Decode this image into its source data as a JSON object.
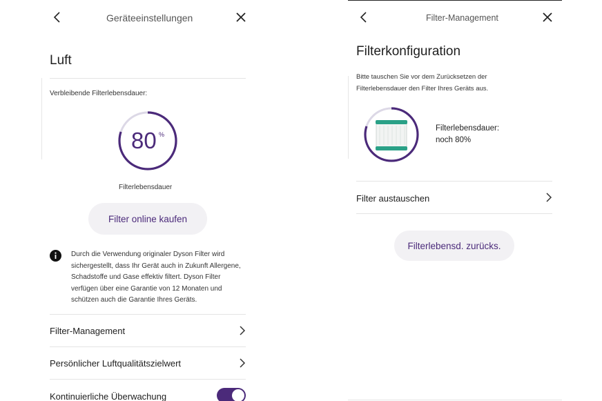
{
  "colors": {
    "accent": "#4b2a7a",
    "ring_track": "#dcd8e6",
    "toggle_on": "#4b2a7a",
    "pill_bg": "#f2f1f4"
  },
  "left": {
    "header": {
      "title": "Geräteeinstellungen",
      "back_icon": "chevron-left-icon",
      "close_icon": "close-icon"
    },
    "section_title": "Luft",
    "remaining_label": "Verbleibende Filterlebensdauer:",
    "gauge": {
      "value": "80",
      "unit": "%",
      "fraction": 0.8,
      "caption": "Filterlebensdauer"
    },
    "buy_button": "Filter online kaufen",
    "info_icon": "info-icon",
    "info_text": "Durch die Verwendung originaler Dyson Filter wird sichergestellt, dass Ihr Gerät auch in Zukunft Allergene, Schadstoffe und Gase effektiv filtert. Dyson Filter verfügen über eine Garantie von 12 Monaten und schützen auch die Garantie Ihres Geräts.",
    "rows": [
      {
        "label": "Filter-Management"
      },
      {
        "label": "Persönlicher Luftqualitätszielwert"
      },
      {
        "label": "Kontinuierliche Überwachung",
        "toggle": "on"
      }
    ]
  },
  "right": {
    "header": {
      "title": "Filter-Management",
      "back_icon": "chevron-left-icon",
      "close_icon": "close-icon"
    },
    "section_title": "Filterkonfiguration",
    "instruction": "Bitte tauschen Sie vor dem Zurücksetzen der Filterlebensdauer den Filter Ihres Geräts aus.",
    "filter_image": "filter-cartridge-icon",
    "gauge_fraction": 0.8,
    "life_label": "Filterlebensdauer:",
    "life_value": "noch 80%",
    "row": "Filter austauschen",
    "reset_button": "Filterlebensd. zurücks."
  }
}
